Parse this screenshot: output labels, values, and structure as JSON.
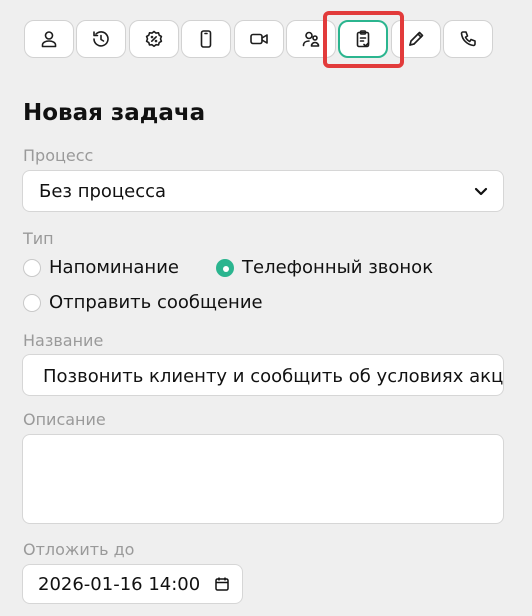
{
  "toolbar": {
    "buttons": [
      {
        "icon": "user-icon"
      },
      {
        "icon": "history-icon"
      },
      {
        "icon": "discount-badge-icon"
      },
      {
        "icon": "mobile-phone-icon"
      },
      {
        "icon": "video-camera-icon"
      },
      {
        "icon": "users-icon"
      },
      {
        "icon": "clipboard-check-icon",
        "active": true
      },
      {
        "icon": "pencil-icon"
      },
      {
        "icon": "phone-icon"
      }
    ],
    "active_color": "#2bb58f",
    "highlight_color": "#e23b3b"
  },
  "form": {
    "title": "Новая задача",
    "process_label": "Процесс",
    "process_value": "Без процесса",
    "type_label": "Тип",
    "type_options": [
      {
        "label": "Напоминание",
        "selected": false
      },
      {
        "label": "Телефонный звонок",
        "selected": true
      },
      {
        "label": "Отправить сообщение",
        "selected": false
      }
    ],
    "name_label": "Название",
    "name_value": "Позвонить клиенту и сообщить об условиях акции",
    "description_label": "Описание",
    "description_value": "",
    "postpone_label": "Отложить до",
    "postpone_value": "2026-01-16 14:00"
  }
}
